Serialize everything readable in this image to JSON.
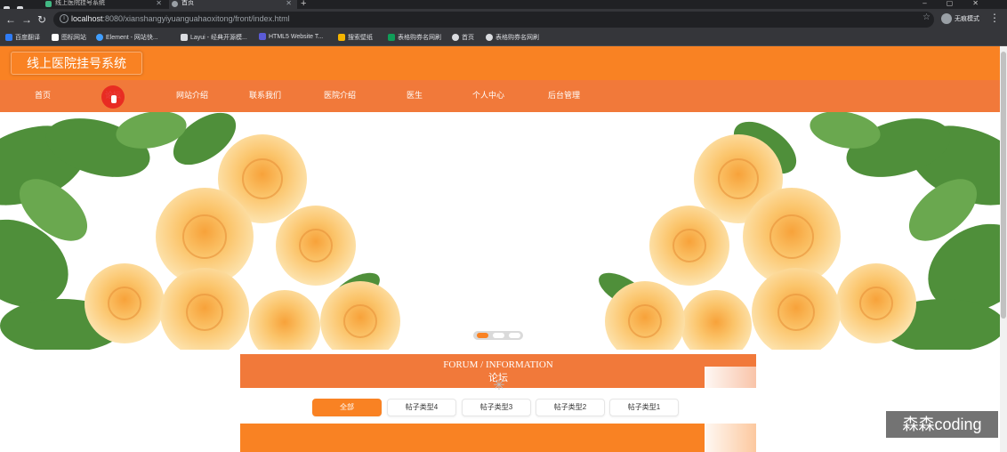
{
  "browser": {
    "tabs": [
      {
        "label": "线上医院挂号系统"
      },
      {
        "label": "首页"
      }
    ],
    "url_host": "localhost",
    "url_path": ":8080/xianshangyiyuanguahaoxitong/front/index.html",
    "profile_label": "无痕模式",
    "bookmarks": [
      {
        "label": "百度翻译",
        "color": "#2f7cf6"
      },
      {
        "label": "图标网站",
        "color": "#ffffff"
      },
      {
        "label": "Element - 网站快...",
        "color": "#409eff"
      },
      {
        "label": "Layui - 经典开源模...",
        "color": "#dadce0"
      },
      {
        "label": "HTML5 Website T...",
        "color": "#5b5bd6"
      },
      {
        "label": "搜索壁纸",
        "color": "#f4b400"
      },
      {
        "label": "表格购券名网刷",
        "color": "#0f9d58"
      },
      {
        "label": "首页",
        "color": "#dadce0"
      },
      {
        "label": "表格购券名网刷",
        "color": "#dadce0"
      }
    ]
  },
  "site": {
    "logo": "线上医院挂号系统",
    "nav": [
      "首页",
      "论坛",
      "网站介绍",
      "联系我们",
      "医院介绍",
      "医生",
      "个人中心",
      "后台管理"
    ],
    "forum_title_en": "FORUM / INFORMATION",
    "forum_title_cn": "论坛",
    "filters": [
      "全部",
      "帖子类型4",
      "帖子类型3",
      "帖子类型2",
      "帖子类型1"
    ],
    "active_filter": "全部",
    "carousel_active_index": 0
  },
  "colors": {
    "header": "#f98223",
    "nav": "#f1793a",
    "accent": "#f98223"
  },
  "watermark": "森森coding"
}
